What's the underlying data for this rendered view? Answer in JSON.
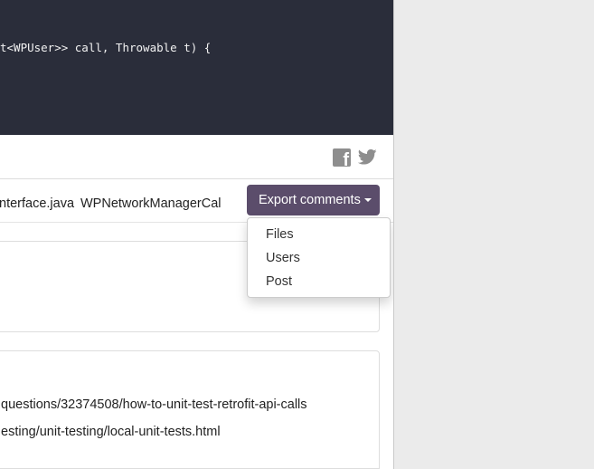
{
  "code": {
    "line": "t<WPUser>> call, Throwable t) {"
  },
  "share": {
    "facebook_glyph": "f",
    "facebook_icon": "facebook-icon",
    "twitter_icon": "twitter-icon",
    "icon_color": "#8e8e8e"
  },
  "files": {
    "tabs": [
      "nterface.java",
      "WPNetworkManagerCal"
    ]
  },
  "export": {
    "label": "Export comments",
    "color": "#5b4d6b",
    "menu": [
      "Files",
      "Users",
      "Post"
    ]
  },
  "comments": {
    "links": [
      "questions/32374508/how-to-unit-test-retrofit-api-calls",
      "esting/unit-testing/local-unit-tests.html"
    ]
  }
}
